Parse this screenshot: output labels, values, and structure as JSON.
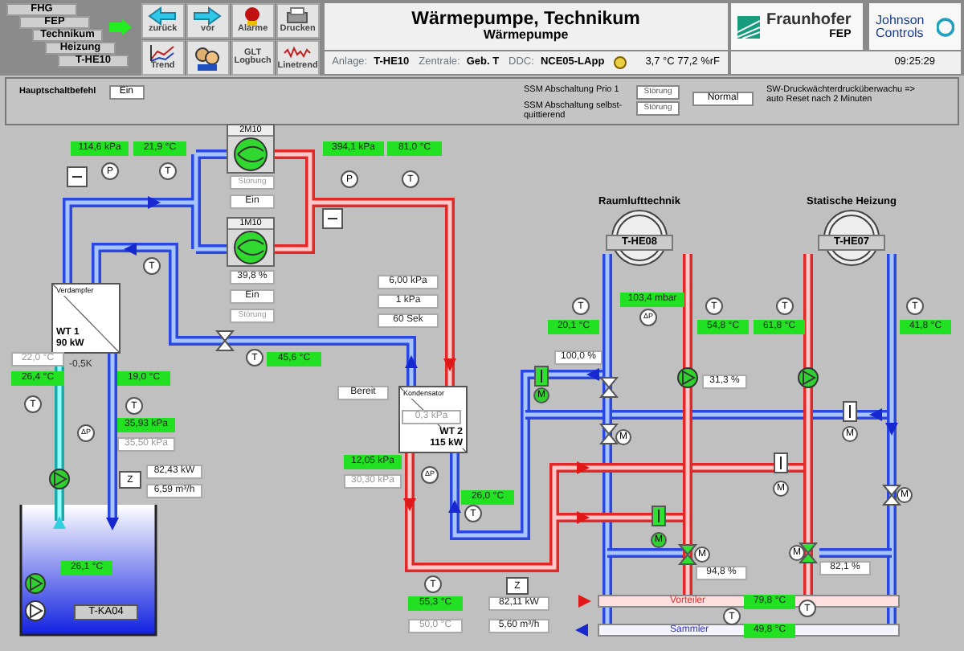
{
  "nav_path": [
    {
      "label": "FHG"
    },
    {
      "label": "FEP"
    },
    {
      "label": "Technikum"
    },
    {
      "label": "Heizung"
    },
    {
      "label": "T-HE10"
    }
  ],
  "toolbar": [
    {
      "kind": "back",
      "label": "zurück"
    },
    {
      "kind": "forward",
      "label": "vor"
    },
    {
      "kind": "alarm",
      "label": "Alarme"
    },
    {
      "kind": "print",
      "label": "Drucken"
    },
    {
      "kind": "trend",
      "label": "Trend"
    },
    {
      "kind": "users"
    },
    {
      "kind": "logbook",
      "label": "GLT Logbuch"
    },
    {
      "kind": "linetrend",
      "label": "Linetrend"
    }
  ],
  "title": "Wärmepumpe, Technikum",
  "subtitle": "Wärmepumpe",
  "info": [
    {
      "label": "Anlage:",
      "value": "T-HE10"
    },
    {
      "label": "Zentrale:",
      "value": "Geb. T"
    },
    {
      "label": "DDC:",
      "value": "NCE05-LApp"
    }
  ],
  "outdoor": "3,7 °C 77,2 %rF",
  "logos": {
    "fraunhofer": "Fraunhofer",
    "fraunhofer_unit": "FEP",
    "jci": "Johnson Controls"
  },
  "time": "09:25:29",
  "panel": {
    "main_switch": {
      "label": "Hauptschaltbefehl",
      "value": "Ein"
    },
    "ssm": [
      {
        "label": "SSM Abschaltung Prio 1",
        "value": "Störung"
      },
      {
        "label": "SSM Abschaltung selbst-quittierend",
        "value": "Störung"
      }
    ],
    "pressure_status": "Normal",
    "pressure_note": "SW-Druckwächterdrucküberwachu => auto Reset nach 2 Minuten"
  },
  "compressors": [
    {
      "name": "2M10",
      "running": true
    },
    {
      "name": "1M10",
      "running": true
    }
  ],
  "heat_exchangers": [
    {
      "title": "Verdampfer",
      "name": "WT 1",
      "power": "90 kW"
    },
    {
      "title": "Kondensator",
      "name": "WT 2",
      "power": "115 kW"
    }
  ],
  "consumers": [
    {
      "title": "Raumlufttechnik",
      "name": "T-HE08"
    },
    {
      "title": "Statische Heizung",
      "name": "T-HE07"
    }
  ],
  "tank": {
    "name": "T-KA04"
  },
  "headers": [
    {
      "kind": "supply",
      "name": "Vorteiler"
    },
    {
      "kind": "return",
      "name": "Sammler"
    }
  ],
  "pumps": [
    {
      "running": true
    },
    {
      "running": true
    },
    {
      "running": false
    },
    {
      "running": true
    },
    {
      "running": true
    }
  ],
  "readings": [
    {
      "kind": "measured",
      "text": "114,6 kPa"
    },
    {
      "kind": "measured",
      "text": "21,9 °C"
    },
    {
      "kind": "measured",
      "text": "394,1 kPa"
    },
    {
      "kind": "measured",
      "text": "81,0 °C"
    },
    {
      "kind": "status_off",
      "text": "Störung"
    },
    {
      "kind": "field",
      "text": "Ein"
    },
    {
      "kind": "field",
      "text": "39,8 %"
    },
    {
      "kind": "field",
      "text": "Ein"
    },
    {
      "kind": "status_off",
      "text": "Störung"
    },
    {
      "kind": "field",
      "text": "6,00 kPa"
    },
    {
      "kind": "field",
      "text": "1 kPa"
    },
    {
      "kind": "field",
      "text": "60 Sek"
    },
    {
      "kind": "setpoint",
      "text": "22,0 °C"
    },
    {
      "kind": "text",
      "text": "-0,5K"
    },
    {
      "kind": "measured",
      "text": "45,6 °C"
    },
    {
      "kind": "measured",
      "text": "26,4 °C"
    },
    {
      "kind": "measured",
      "text": "19,0 °C"
    },
    {
      "kind": "measured",
      "text": "35,93 kPa"
    },
    {
      "kind": "setpoint",
      "text": "35,50 kPa"
    },
    {
      "kind": "field",
      "text": "82,43 kW"
    },
    {
      "kind": "field",
      "text": "6,59 m³/h"
    },
    {
      "kind": "measured",
      "text": "26,1 °C"
    },
    {
      "kind": "field",
      "text": "Bereit"
    },
    {
      "kind": "setpoint",
      "text": "0,3 kPa"
    },
    {
      "kind": "measured",
      "text": "12,05 kPa"
    },
    {
      "kind": "setpoint",
      "text": "30,30 kPa"
    },
    {
      "kind": "measured",
      "text": "26,0 °C"
    },
    {
      "kind": "measured",
      "text": "55,3 °C"
    },
    {
      "kind": "setpoint",
      "text": "50,0 °C"
    },
    {
      "kind": "field",
      "text": "82,11 kW"
    },
    {
      "kind": "field",
      "text": "5,60 m³/h"
    },
    {
      "kind": "measured",
      "text": "103,4 mbar"
    },
    {
      "kind": "measured",
      "text": "20,1 °C"
    },
    {
      "kind": "measured",
      "text": "54,8 °C"
    },
    {
      "kind": "measured",
      "text": "61,8 °C"
    },
    {
      "kind": "measured",
      "text": "41,8 °C"
    },
    {
      "kind": "field",
      "text": "100,0 %"
    },
    {
      "kind": "field",
      "text": "31,3 %"
    },
    {
      "kind": "field",
      "text": "94,8 %"
    },
    {
      "kind": "field",
      "text": "82,1 %"
    },
    {
      "kind": "measured",
      "text": "79,8 °C"
    },
    {
      "kind": "measured",
      "text": "49,8 °C"
    }
  ],
  "sensors": [
    {
      "symbol": "P"
    },
    {
      "symbol": "T"
    },
    {
      "symbol": "T"
    },
    {
      "symbol": "T"
    },
    {
      "symbol": "P"
    },
    {
      "symbol": "T"
    },
    {
      "symbol": "T"
    },
    {
      "symbol": "ΔP"
    },
    {
      "symbol": "T"
    },
    {
      "symbol": "Z"
    },
    {
      "symbol": "ΔP"
    },
    {
      "symbol": "T"
    },
    {
      "symbol": "T"
    },
    {
      "symbol": "Z"
    },
    {
      "symbol": "T"
    },
    {
      "symbol": "ΔP"
    },
    {
      "symbol": "T"
    },
    {
      "symbol": "T"
    },
    {
      "symbol": "T"
    },
    {
      "symbol": "T"
    },
    {
      "symbol": "T"
    }
  ],
  "motors": [
    {
      "symbol": "M",
      "running": true
    },
    {
      "symbol": "M",
      "running": false
    },
    {
      "symbol": "M",
      "running": false
    },
    {
      "symbol": "M",
      "running": false
    },
    {
      "symbol": "M",
      "running": false
    },
    {
      "symbol": "M",
      "running": true
    },
    {
      "symbol": "M",
      "running": false
    },
    {
      "symbol": "M",
      "running": false
    }
  ],
  "valves": [
    {
      "active": false
    },
    {
      "active": false
    },
    {
      "active": false
    },
    {
      "active": true
    },
    {
      "active": true
    },
    {
      "active": false
    }
  ],
  "dampers": [
    {
      "active": true
    },
    {
      "active": true
    },
    {
      "active": false
    },
    {
      "active": false
    }
  ]
}
